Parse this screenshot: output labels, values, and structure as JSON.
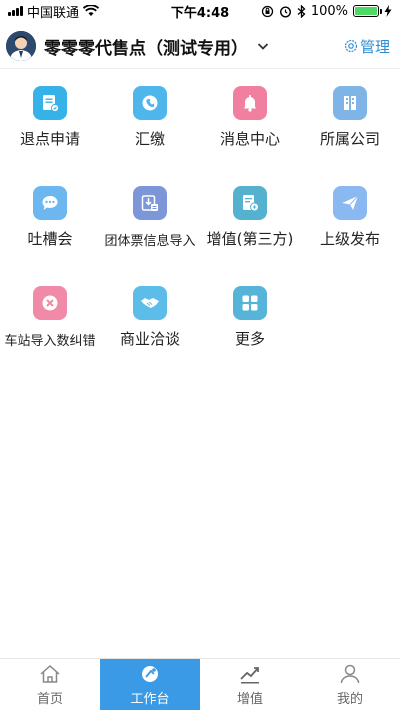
{
  "status_bar": {
    "carrier": "中国联通",
    "time": "下午4:48",
    "battery": "100%"
  },
  "header": {
    "title": "零零零代售点（测试专用）",
    "manage_label": "管理"
  },
  "grid": [
    [
      {
        "label": "退点申请",
        "icon": "refund-form-icon",
        "color": "#37b2e8"
      },
      {
        "label": "汇缴",
        "icon": "remit-icon",
        "color": "#4fb6ec"
      },
      {
        "label": "消息中心",
        "icon": "bell-icon",
        "color": "#f07fa0"
      },
      {
        "label": "所属公司",
        "icon": "building-icon",
        "color": "#7fb4e6"
      }
    ],
    [
      {
        "label": "吐槽会",
        "icon": "chat-bubble-icon",
        "color": "#6cb7ef"
      },
      {
        "label": "团体票信息导入",
        "icon": "import-icon",
        "color": "#7d96d8"
      },
      {
        "label": "增值(第三方)",
        "icon": "value-added-icon",
        "color": "#54b2cf"
      },
      {
        "label": "上级发布",
        "icon": "send-icon",
        "color": "#8ab8f0"
      }
    ],
    [
      {
        "label": "车站导入数纠错",
        "icon": "error-correct-icon",
        "color": "#f08aa8"
      },
      {
        "label": "商业洽谈",
        "icon": "handshake-icon",
        "color": "#5cbde8"
      },
      {
        "label": "更多",
        "icon": "more-grid-icon",
        "color": "#56b4d8"
      }
    ]
  ],
  "tabbar": [
    {
      "label": "首页",
      "icon": "home-icon",
      "active": false
    },
    {
      "label": "工作台",
      "icon": "workbench-icon",
      "active": true
    },
    {
      "label": "增值",
      "icon": "trend-icon",
      "active": false
    },
    {
      "label": "我的",
      "icon": "profile-icon",
      "active": false
    }
  ]
}
